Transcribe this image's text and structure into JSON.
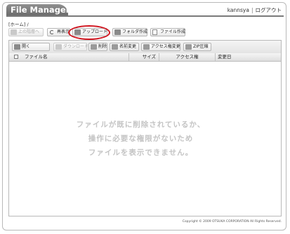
{
  "app": {
    "title": "File Manager",
    "username": "kannsya",
    "separator": "|",
    "logout": "ログアウト"
  },
  "breadcrumb": "[ホーム] /",
  "toolbar": {
    "up": "上の階層へ",
    "reload": "再表示",
    "upload": "アップロード",
    "new_folder": "フォルダ作成",
    "new_file": "ファイル作成"
  },
  "file_toolbar": {
    "open": "開く",
    "download": "ダウンロード",
    "delete": "削除",
    "rename": "名前変更",
    "permissions": "アクセス権変更",
    "zip": "ZIP圧縮"
  },
  "table": {
    "columns": [
      "ファイル名",
      "サイズ",
      "アクセス権",
      "変更日"
    ]
  },
  "empty_message": [
    "ファイルが既に削除されているか、",
    "操作に必要な権限がないため",
    "ファイルを表示できません。"
  ],
  "copyright": "Copyright © 2009 OTSUKA CORPORATION All Rights Reserved.",
  "colors": {
    "highlight": "#d0141e",
    "title_bar": "#7a7a7a"
  }
}
